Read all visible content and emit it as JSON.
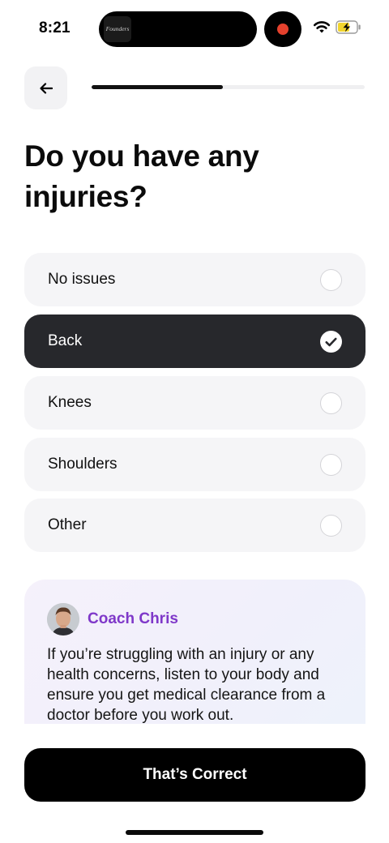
{
  "status_bar": {
    "time": "8:21",
    "island_thumb_text": "Founders",
    "recording_color": "#e5412d",
    "battery_state": "charging"
  },
  "header": {
    "back_icon": "arrow-left-icon",
    "progress_fraction": 0.48
  },
  "question": {
    "title": "Do you have any injuries?"
  },
  "options": [
    {
      "label": "No issues",
      "selected": false
    },
    {
      "label": "Back",
      "selected": true
    },
    {
      "label": "Knees",
      "selected": false
    },
    {
      "label": "Shoulders",
      "selected": false
    },
    {
      "label": "Other",
      "selected": false
    }
  ],
  "coach": {
    "name": "Coach Chris",
    "message": "If you’re struggling with an injury or any health concerns, listen to your body and ensure you get medical clearance from a doctor before you work out.",
    "name_color": "#7f38c9"
  },
  "cta": {
    "label": "That’s Correct"
  }
}
